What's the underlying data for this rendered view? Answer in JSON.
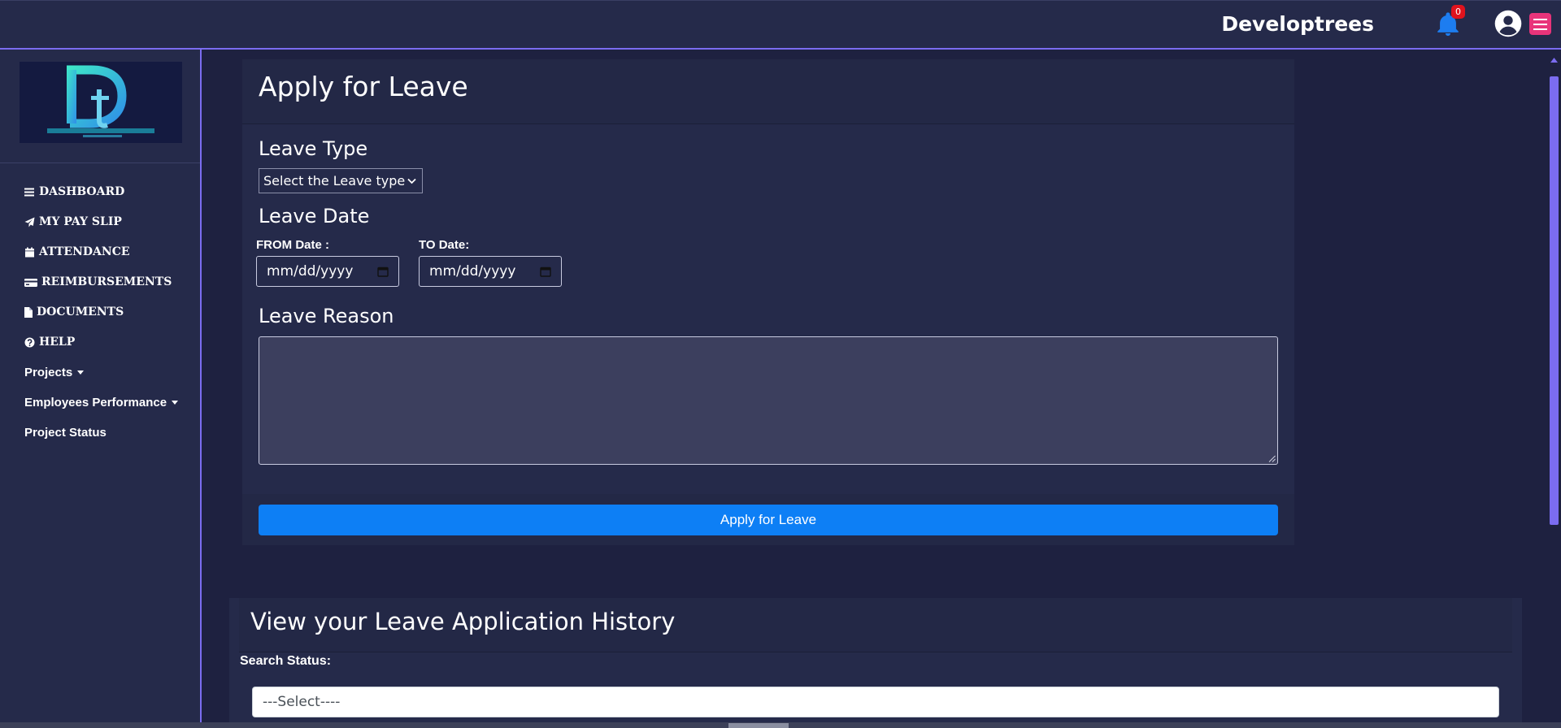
{
  "header": {
    "brand": "Developtrees",
    "notification_count": "0"
  },
  "sidebar": {
    "logo_alt": "Developtrees",
    "items": [
      {
        "label": "DASHBOARD",
        "icon": "bars-icon"
      },
      {
        "label": "MY PAY SLIP",
        "icon": "paper-plane-icon"
      },
      {
        "label": "ATTENDANCE",
        "icon": "calendar-icon"
      },
      {
        "label": "REIMBURSEMENTS",
        "icon": "credit-card-icon"
      },
      {
        "label": "DOCUMENTS",
        "icon": "file-icon"
      },
      {
        "label": "HELP",
        "icon": "question-circle-icon"
      },
      {
        "label": "Projects",
        "icon": "caret-down-icon"
      },
      {
        "label": "Employees Performance",
        "icon": "caret-down-icon"
      },
      {
        "label": "Project Status",
        "icon": ""
      }
    ]
  },
  "apply_form": {
    "title": "Apply for Leave",
    "leave_type_label": "Leave Type",
    "leave_type_select": "Select the Leave type",
    "leave_date_label": "Leave Date",
    "from_label": "FROM Date :",
    "to_label": "TO Date:",
    "from_value": "mm/dd/yyyy",
    "to_value": "mm/dd/yyyy",
    "reason_label": "Leave Reason",
    "reason_value": "",
    "submit_label": "Apply for Leave"
  },
  "history": {
    "title": "View your Leave Application History",
    "search_label": "Search Status:",
    "status_select": "---Select----"
  },
  "colors": {
    "background": "#1e2140",
    "panel": "#252a4a",
    "accent": "#7b6cf0",
    "primary_button": "#0d7ff5",
    "menu_button": "#e8347a",
    "badge": "#e0131d",
    "bell": "#1d7df0"
  }
}
